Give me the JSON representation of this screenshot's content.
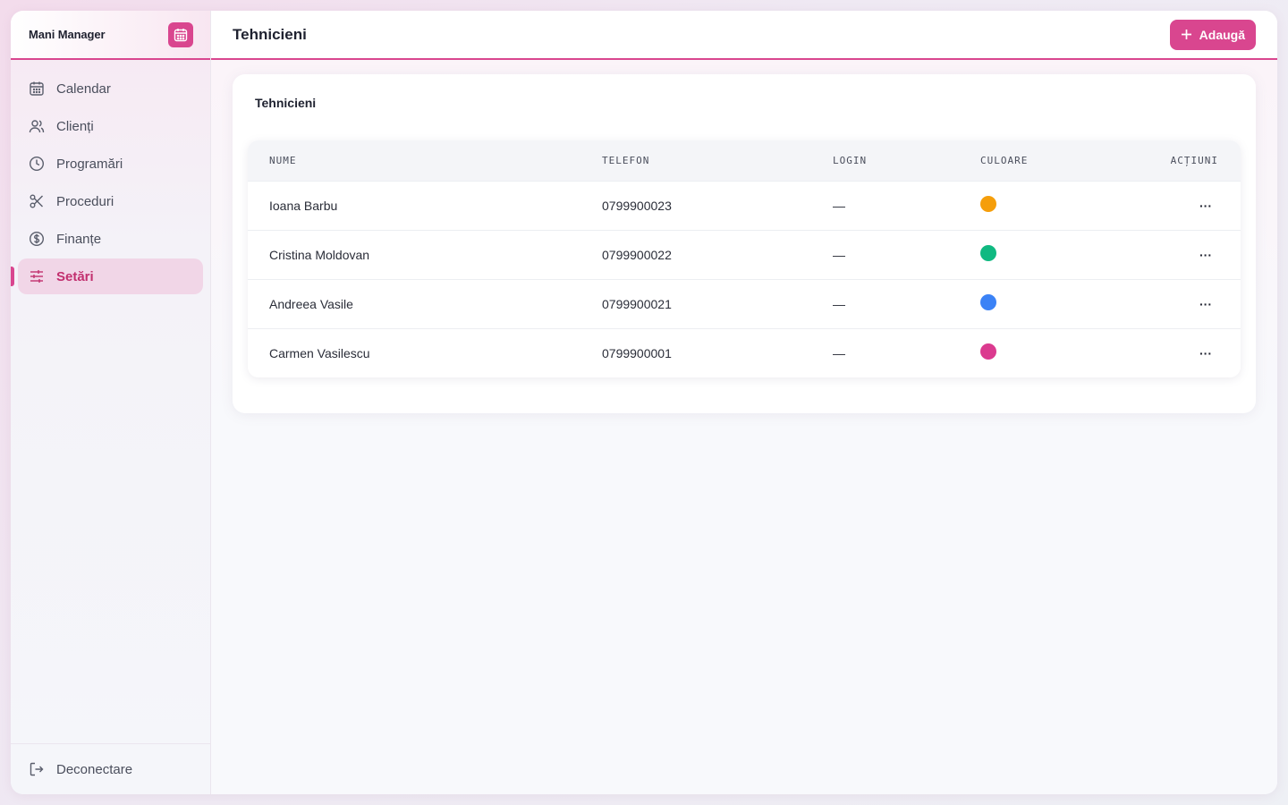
{
  "sidebar": {
    "brand": "Mani Manager",
    "items": [
      {
        "label": "Calendar",
        "icon": "calendar-icon"
      },
      {
        "label": "Clienți",
        "icon": "users-icon"
      },
      {
        "label": "Programări",
        "icon": "clock-icon"
      },
      {
        "label": "Proceduri",
        "icon": "scissors-icon"
      },
      {
        "label": "Finanțe",
        "icon": "dollar-circle-icon"
      },
      {
        "label": "Setări",
        "icon": "sliders-icon",
        "active": true
      }
    ],
    "logout": "Deconectare"
  },
  "header": {
    "title": "Tehnicieni",
    "add_label": "Adaugă"
  },
  "card": {
    "title": "Tehnicieni",
    "columns": [
      "NUME",
      "TELEFON",
      "LOGIN",
      "CULOARE",
      "ACȚIUNI"
    ],
    "rows": [
      {
        "name": "Ioana Barbu",
        "phone": "0799900023",
        "login": "—",
        "color": "#f59e0b",
        "actions": "···"
      },
      {
        "name": "Cristina Moldovan",
        "phone": "0799900022",
        "login": "—",
        "color": "#10b981",
        "actions": "···"
      },
      {
        "name": "Andreea Vasile",
        "phone": "0799900021",
        "login": "—",
        "color": "#3b82f6",
        "actions": "···"
      },
      {
        "name": "Carmen Vasilescu",
        "phone": "0799900001",
        "login": "—",
        "color": "#db3a8f",
        "actions": "···"
      }
    ]
  },
  "colors": {
    "accent": "#d9468f",
    "active_bg": "#f1d6e7"
  }
}
